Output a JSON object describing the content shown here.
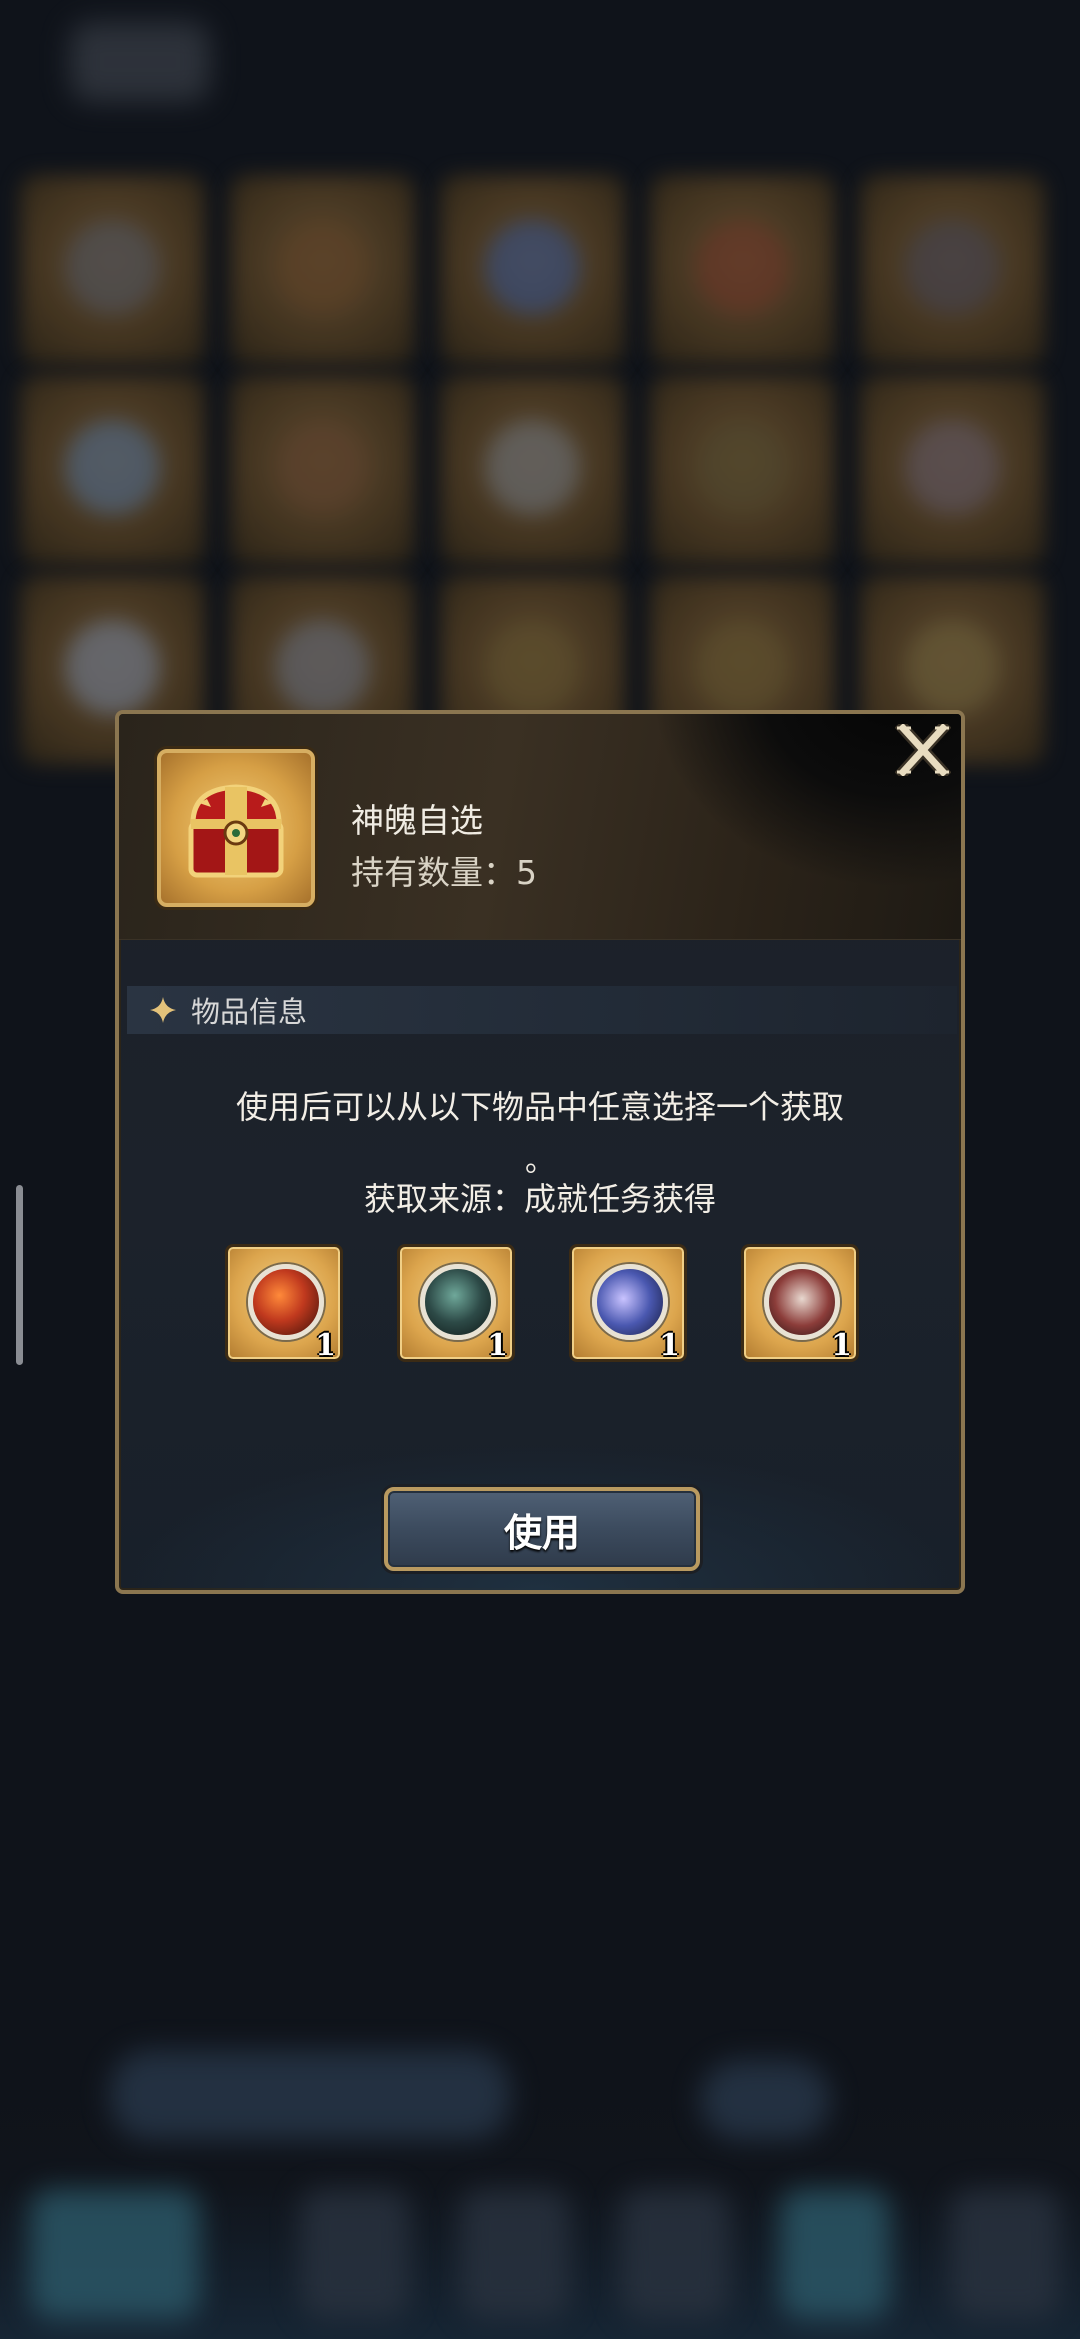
{
  "item": {
    "name": "神魄自选",
    "count_label": "持有数量：",
    "count": "5",
    "icon": "treasure-chest-icon"
  },
  "section": {
    "title": "物品信息",
    "icon": "sparkle-icon"
  },
  "description": {
    "line1": "使用后可以从以下物品中任意选择一个获取",
    "line2": "。",
    "source": "获取来源：成就任务获得"
  },
  "rewards": [
    {
      "icon": "fire-orb-icon",
      "quantity": "1",
      "color": "#c0391e"
    },
    {
      "icon": "dark-orb-icon",
      "quantity": "1",
      "color": "#2d4a47"
    },
    {
      "icon": "blue-orb-icon",
      "quantity": "1",
      "color": "#4a58b0"
    },
    {
      "icon": "crimson-orb-icon",
      "quantity": "1",
      "color": "#8c3d3a"
    }
  ],
  "actions": {
    "use_label": "使用",
    "close_icon": "close-icon"
  },
  "colors": {
    "frame_gold": "#8b7650",
    "modal_bg": "#1c222b",
    "button_bg": "#3c4b5e"
  }
}
